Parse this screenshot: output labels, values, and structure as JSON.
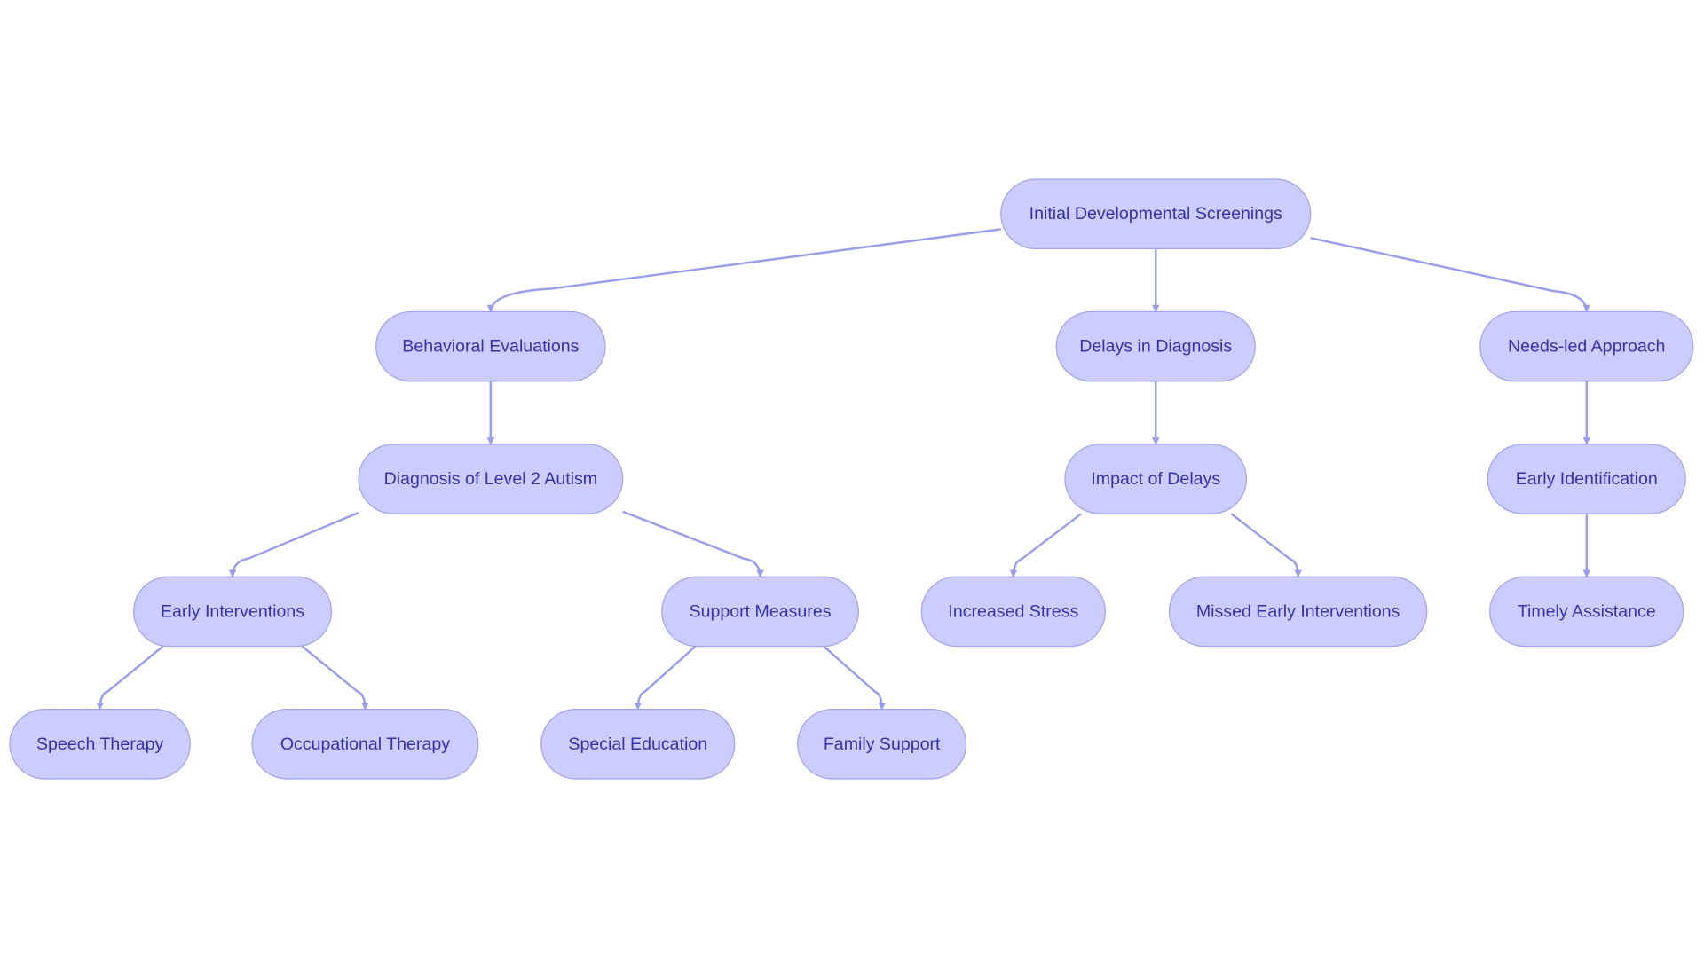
{
  "colors": {
    "node_fill": "#ccccff",
    "node_stroke": "#9fa3ea",
    "edge": "#9a9de8",
    "text": "#3333a8"
  },
  "nodes": [
    {
      "id": "initial",
      "label": "Initial Developmental Screenings"
    },
    {
      "id": "behavioral",
      "label": "Behavioral Evaluations"
    },
    {
      "id": "delays",
      "label": "Delays in Diagnosis"
    },
    {
      "id": "needs",
      "label": "Needs-led Approach"
    },
    {
      "id": "diagnosis",
      "label": "Diagnosis of Level 2 Autism"
    },
    {
      "id": "impact",
      "label": "Impact of Delays"
    },
    {
      "id": "earlyid",
      "label": "Early Identification"
    },
    {
      "id": "earlyint",
      "label": "Early Interventions"
    },
    {
      "id": "support",
      "label": "Support Measures"
    },
    {
      "id": "stress",
      "label": "Increased Stress"
    },
    {
      "id": "missed",
      "label": "Missed Early Interventions"
    },
    {
      "id": "timely",
      "label": "Timely Assistance"
    },
    {
      "id": "speech",
      "label": "Speech Therapy"
    },
    {
      "id": "occupational",
      "label": "Occupational Therapy"
    },
    {
      "id": "special",
      "label": "Special Education"
    },
    {
      "id": "family",
      "label": "Family Support"
    }
  ],
  "edges": [
    {
      "from": "initial",
      "to": "behavioral"
    },
    {
      "from": "initial",
      "to": "delays"
    },
    {
      "from": "initial",
      "to": "needs"
    },
    {
      "from": "behavioral",
      "to": "diagnosis"
    },
    {
      "from": "delays",
      "to": "impact"
    },
    {
      "from": "needs",
      "to": "earlyid"
    },
    {
      "from": "diagnosis",
      "to": "earlyint"
    },
    {
      "from": "diagnosis",
      "to": "support"
    },
    {
      "from": "impact",
      "to": "stress"
    },
    {
      "from": "impact",
      "to": "missed"
    },
    {
      "from": "earlyid",
      "to": "timely"
    },
    {
      "from": "earlyint",
      "to": "speech"
    },
    {
      "from": "earlyint",
      "to": "occupational"
    },
    {
      "from": "support",
      "to": "special"
    },
    {
      "from": "support",
      "to": "family"
    }
  ]
}
